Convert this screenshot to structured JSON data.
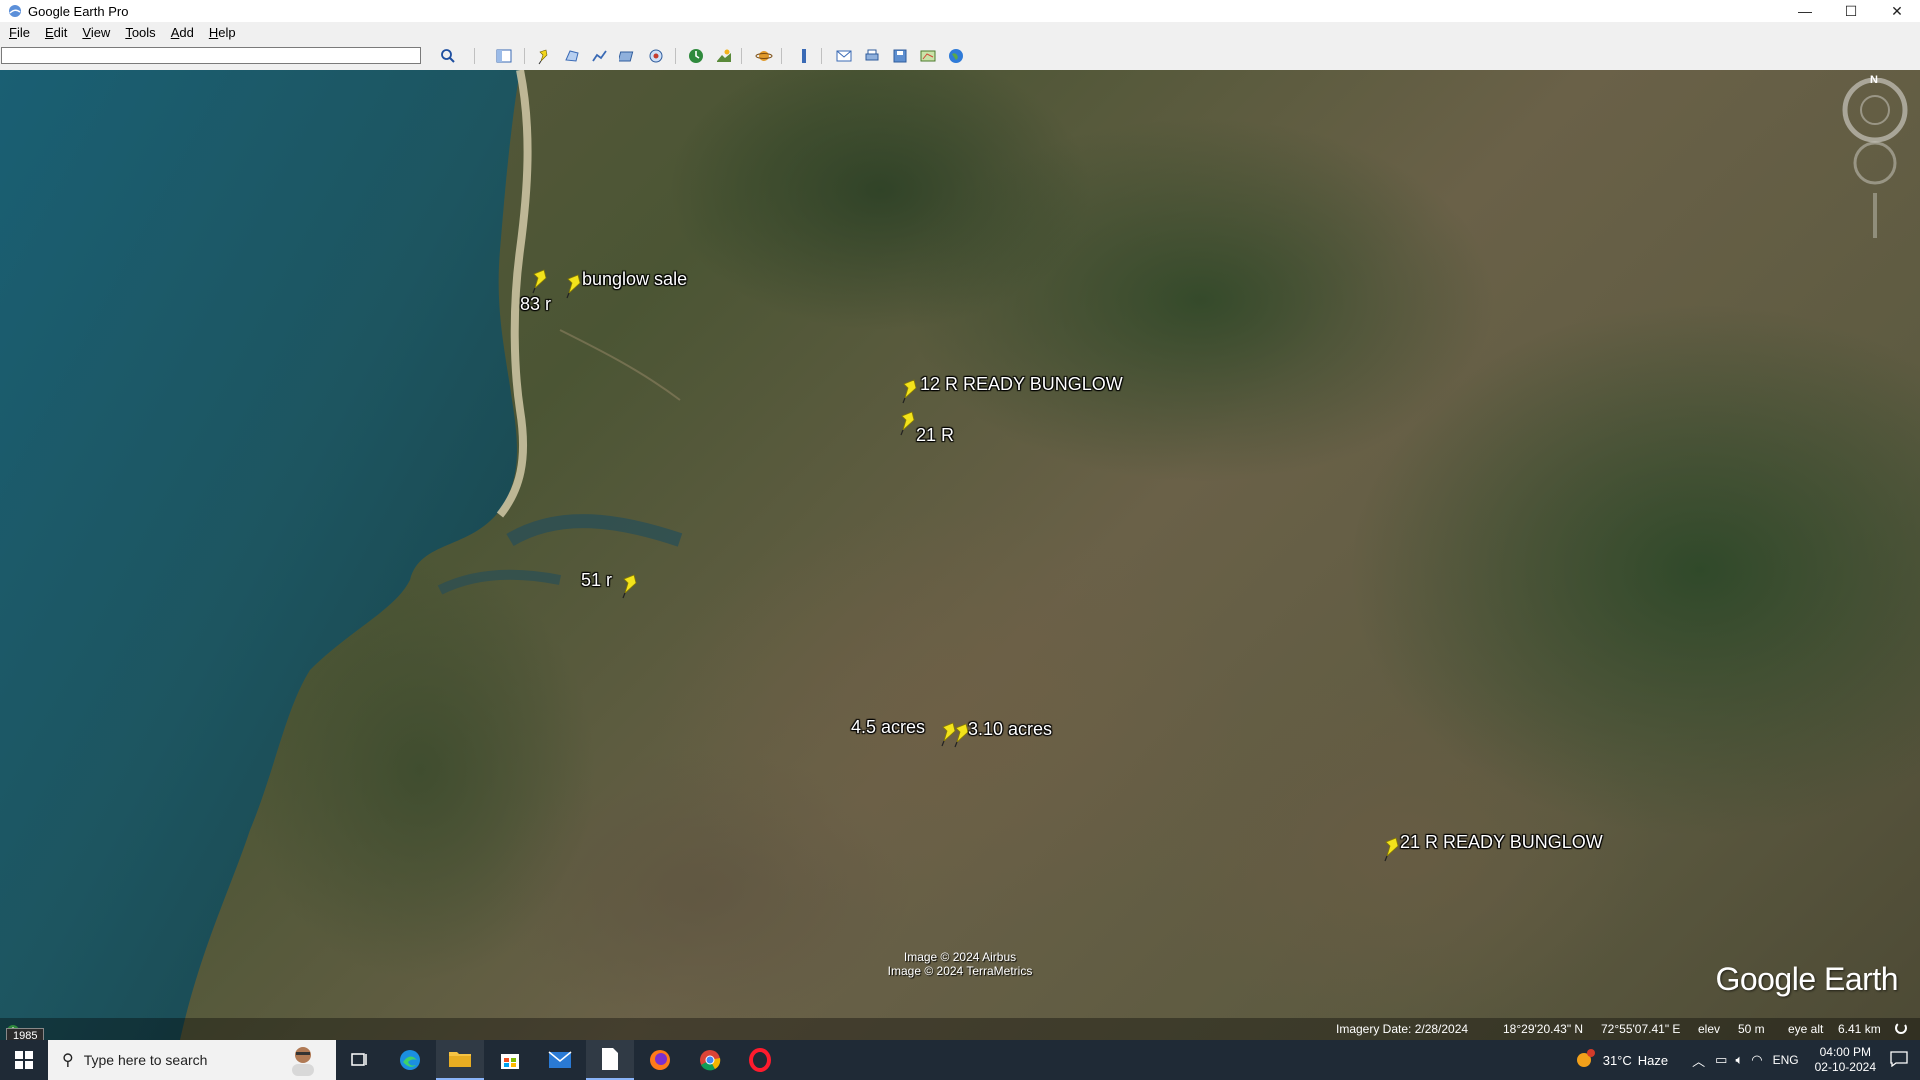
{
  "window": {
    "title": "Google Earth Pro",
    "controls": {
      "minimize": "—",
      "maximize": "☐",
      "close": "✕"
    }
  },
  "menu": {
    "items": [
      {
        "label": "File",
        "accel": "F",
        "rest": "ile"
      },
      {
        "label": "Edit",
        "accel": "E",
        "rest": "dit"
      },
      {
        "label": "View",
        "accel": "V",
        "rest": "iew"
      },
      {
        "label": "Tools",
        "accel": "T",
        "rest": "ools"
      },
      {
        "label": "Add",
        "accel": "A",
        "rest": "dd"
      },
      {
        "label": "Help",
        "accel": "H",
        "rest": "elp"
      }
    ]
  },
  "search": {
    "value": "",
    "placeholder": ""
  },
  "toolbar": {
    "icons": [
      "search-icon",
      "sidebar-icon",
      "placemark-icon",
      "polygon-icon",
      "path-icon",
      "image-overlay-icon",
      "record-tour-icon",
      "historical-imagery-icon",
      "sun-icon",
      "planets-icon",
      "ruler-icon",
      "email-icon",
      "print-icon",
      "save-image-icon",
      "map-icon",
      "earth-icon"
    ]
  },
  "placemarks": [
    {
      "name": "83 r"
    },
    {
      "name": "bunglow sale"
    },
    {
      "name": "12 R READY BUNGLOW"
    },
    {
      "name": "21 R"
    },
    {
      "name": "51 r"
    },
    {
      "name": "4.5 acres"
    },
    {
      "name": "3.10 acres"
    },
    {
      "name": "21 R READY BUNGLOW"
    }
  ],
  "credits": {
    "line1": "Image © 2024 Airbus",
    "line2": "Image © 2024 TerraMetrics"
  },
  "logo": "Google Earth",
  "compass_north": "N",
  "status": {
    "imagery_date": "Imagery Date: 2/28/2024",
    "lat": "18°29'20.43\" N",
    "lon": "72°55'07.41\" E",
    "elev_label": "elev",
    "elev_value": "50 m",
    "eye_alt_label": "eye alt",
    "eye_alt_value": "6.41 km",
    "historical_year": "1985"
  },
  "taskbar": {
    "search_placeholder": "Type here to search",
    "weather_temp": "31°C",
    "weather_desc": "Haze",
    "language": "ENG",
    "time": "04:00 PM",
    "date": "02-10-2024"
  },
  "colors": {
    "pin": "#f5e c1a",
    "taskbar": "#1f2a36",
    "sea": "#1d5a6a"
  }
}
